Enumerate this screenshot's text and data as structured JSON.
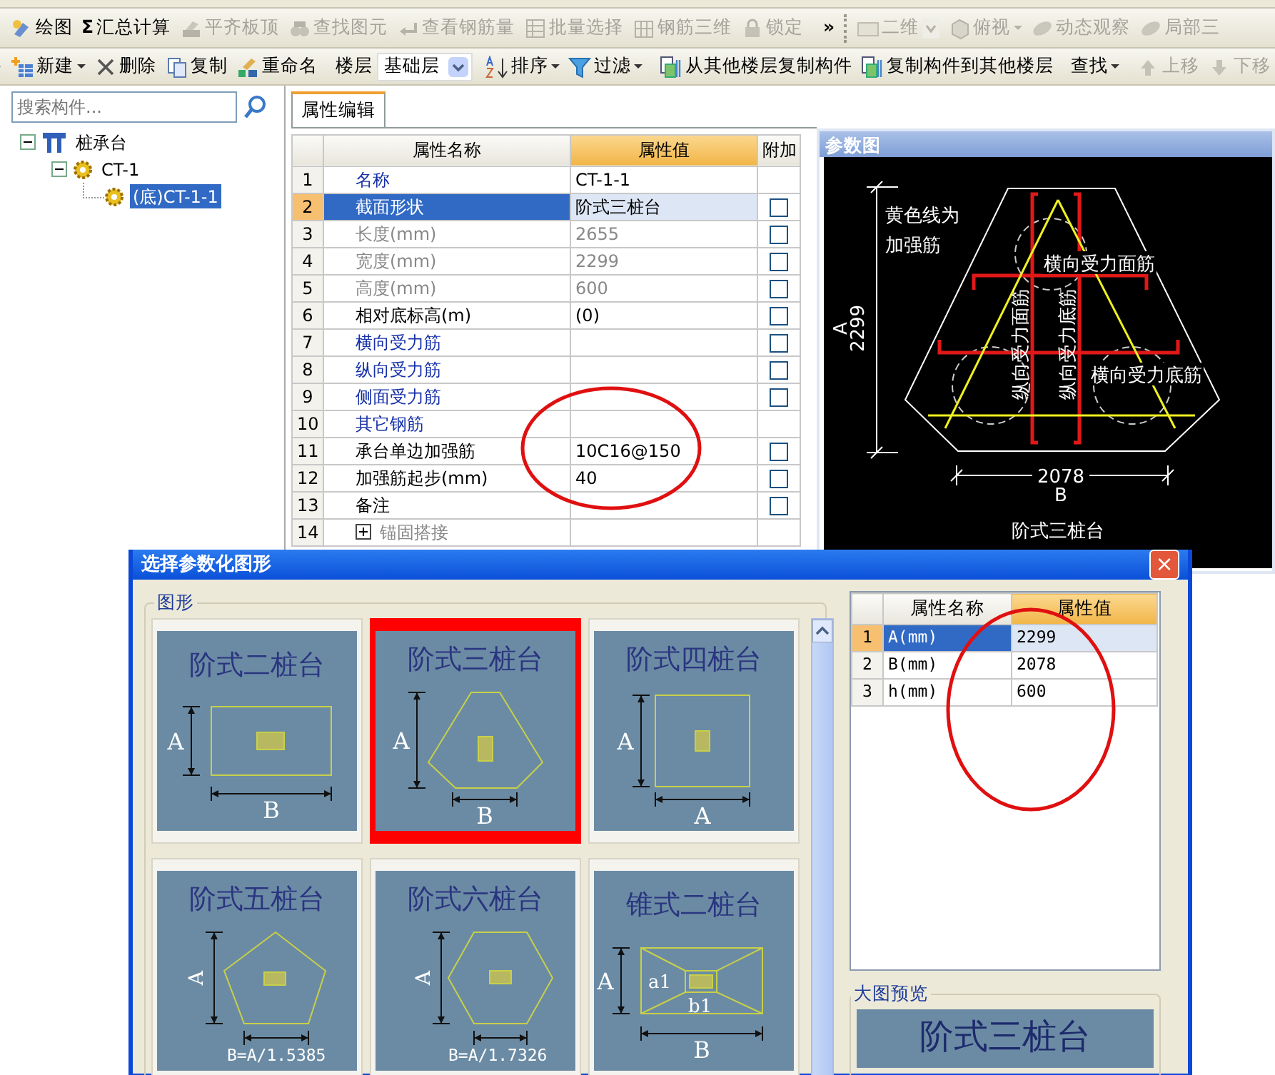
{
  "toolbar_main": {
    "items": [
      {
        "label": "绘图",
        "disabled": false
      },
      {
        "label": "汇总计算",
        "disabled": false,
        "icon_text": "Σ"
      },
      {
        "label": "平齐板顶",
        "disabled": true
      },
      {
        "label": "查找图元",
        "disabled": true
      },
      {
        "label": "查看钢筋量",
        "disabled": true
      },
      {
        "label": "批量选择",
        "disabled": true
      },
      {
        "label": "钢筋三维",
        "disabled": true
      },
      {
        "label": "锁定",
        "disabled": true
      }
    ],
    "overflow": "»",
    "view_items": [
      {
        "label": "二维",
        "kind": "dropdown",
        "disabled": true
      },
      {
        "label": "俯视",
        "kind": "menu",
        "disabled": true
      },
      {
        "label": "动态观察",
        "kind": "button",
        "disabled": true
      },
      {
        "label": "局部三",
        "kind": "button",
        "disabled": true
      }
    ]
  },
  "toolbar_component": {
    "items": [
      {
        "kind": "menu",
        "label": "新建",
        "disabled": false
      },
      {
        "kind": "button",
        "label": "删除",
        "disabled": false
      },
      {
        "kind": "button",
        "label": "复制",
        "disabled": false
      },
      {
        "kind": "button",
        "label": "重命名",
        "disabled": false
      },
      {
        "kind": "separator"
      },
      {
        "kind": "label",
        "label": "楼层"
      },
      {
        "kind": "select",
        "value": "基础层"
      },
      {
        "kind": "separator"
      },
      {
        "kind": "menu",
        "label": "排序",
        "disabled": false
      },
      {
        "kind": "menu",
        "label": "过滤",
        "disabled": false
      },
      {
        "kind": "separator"
      },
      {
        "kind": "button",
        "label": "从其他楼层复制构件",
        "disabled": false
      },
      {
        "kind": "button",
        "label": "复制构件到其他楼层",
        "disabled": false
      },
      {
        "kind": "separator"
      },
      {
        "kind": "menu",
        "label": "查找",
        "disabled": false
      },
      {
        "kind": "separator"
      },
      {
        "kind": "button",
        "label": "上移",
        "disabled": true
      },
      {
        "kind": "button",
        "label": "下移",
        "disabled": true
      }
    ]
  },
  "component_panel": {
    "search": {
      "placeholder": "搜索构件..."
    },
    "tree": [
      {
        "label": "桩承台",
        "expanded": true,
        "selected": false,
        "children": [
          {
            "label": "CT-1",
            "expanded": true,
            "selected": false,
            "children": [
              {
                "label": "(底)CT-1-1",
                "selected": true
              }
            ]
          }
        ]
      }
    ]
  },
  "property_panel": {
    "tabs": [
      {
        "label": "属性编辑",
        "selected": true
      }
    ],
    "columns": [
      "属性名称",
      "属性值",
      "附加"
    ],
    "rows": [
      {
        "num": "1",
        "name": "名称",
        "value": "CT-1-1",
        "kind": "link",
        "selected": false
      },
      {
        "num": "2",
        "name": "截面形状",
        "value": "阶式三桩台",
        "kind": "normal",
        "selected": true,
        "checked": false
      },
      {
        "num": "3",
        "name": "长度(mm)",
        "value": "2655",
        "kind": "disabled",
        "selected": false,
        "checked": false
      },
      {
        "num": "4",
        "name": "宽度(mm)",
        "value": "2299",
        "kind": "disabled",
        "selected": false,
        "checked": false
      },
      {
        "num": "5",
        "name": "高度(mm)",
        "value": "600",
        "kind": "disabled",
        "selected": false,
        "checked": false
      },
      {
        "num": "6",
        "name": "相对底标高(m)",
        "value": "(0)",
        "kind": "normal",
        "selected": false,
        "checked": false
      },
      {
        "num": "7",
        "name": "横向受力筋",
        "value": "",
        "kind": "link",
        "selected": false,
        "checked": false
      },
      {
        "num": "8",
        "name": "纵向受力筋",
        "value": "",
        "kind": "link",
        "selected": false,
        "checked": false
      },
      {
        "num": "9",
        "name": "侧面受力筋",
        "value": "",
        "kind": "link",
        "selected": false,
        "checked": false
      },
      {
        "num": "10",
        "name": "其它钢筋",
        "value": "",
        "kind": "link",
        "selected": false
      },
      {
        "num": "11",
        "name": "承台单边加强筋",
        "value": "10C16@150",
        "kind": "normal",
        "selected": false,
        "checked": false
      },
      {
        "num": "12",
        "name": "加强筋起步(mm)",
        "value": "40",
        "kind": "normal",
        "selected": false,
        "checked": false
      },
      {
        "num": "13",
        "name": "备注",
        "value": "",
        "kind": "normal",
        "selected": false,
        "checked": false
      },
      {
        "num": "14",
        "name": "锚固搭接",
        "value": "",
        "kind": "disabled",
        "selected": false,
        "expanded": false
      }
    ]
  },
  "param_diagram": {
    "title": "参数图",
    "note_lines": [
      "黄色线为",
      "加强筋"
    ],
    "rebar_labels": [
      "横向受力面筋",
      "纵向受力面筋",
      "纵向受力底筋",
      "横向受力底筋"
    ],
    "dim_a_letter": "A",
    "dim_a_value": "2299",
    "dim_b_value": "2078",
    "dim_b_letter": "B",
    "caption": "阶式三桩台"
  },
  "dialog": {
    "title": "选择参数化图形",
    "close": "×",
    "shapes_group": "图形",
    "tiles": [
      {
        "title": "阶式二桩台",
        "kind": "rect",
        "selected": false,
        "side_label": "A",
        "bottom_label": "B"
      },
      {
        "title": "阶式三桩台",
        "kind": "three",
        "selected": true,
        "side_label": "A",
        "bottom_label": "B"
      },
      {
        "title": "阶式四桩台",
        "kind": "square",
        "selected": false,
        "side_label": "A",
        "bottom_label": "A"
      },
      {
        "title": "阶式五桩台",
        "kind": "pentagon",
        "selected": false,
        "side_label": "A",
        "formula": "B=A/1.5385"
      },
      {
        "title": "阶式六桩台",
        "kind": "hexagon",
        "selected": false,
        "side_label": "A",
        "formula": "B=A/1.7326"
      },
      {
        "title": "锥式二桩台",
        "kind": "cone",
        "selected": false,
        "side_label": "A",
        "bottom_label": "B",
        "inner_labels": [
          "a1",
          "b1"
        ]
      }
    ],
    "param_table": {
      "columns": [
        "属性名称",
        "属性值"
      ],
      "rows": [
        {
          "num": "1",
          "name": "A(mm)",
          "value": "2299",
          "selected": true
        },
        {
          "num": "2",
          "name": "B(mm)",
          "value": "2078",
          "selected": false
        },
        {
          "num": "3",
          "name": "h(mm)",
          "value": "600",
          "selected": false
        }
      ]
    },
    "preview_group": "大图预览",
    "preview_title": "阶式三桩台"
  }
}
